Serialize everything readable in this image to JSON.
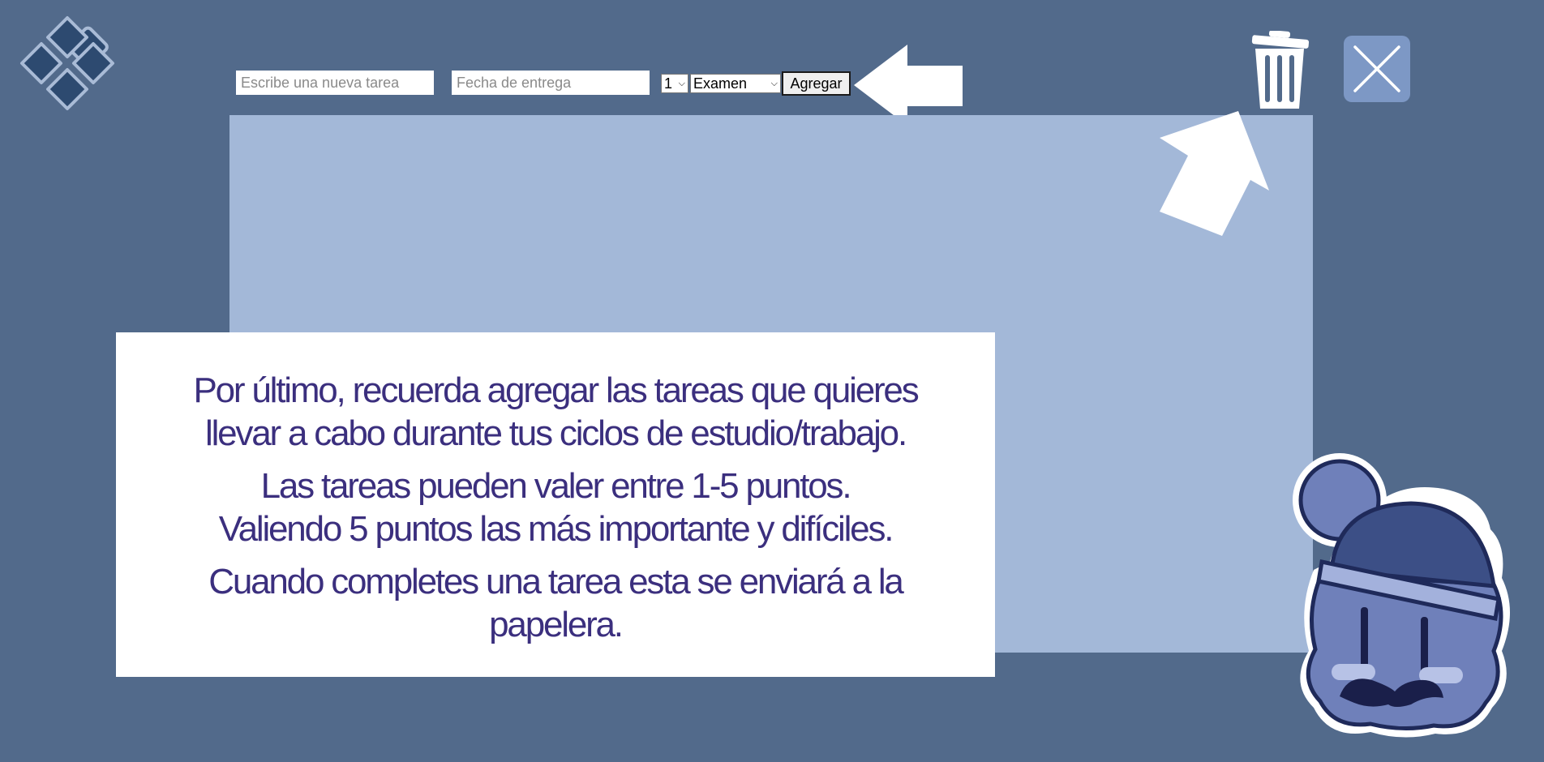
{
  "toolbar": {
    "task_placeholder": "Escribe una nueva tarea",
    "date_placeholder": "Fecha de entrega",
    "points_value": "1",
    "category_value": "Examen",
    "add_label": "Agregar"
  },
  "tutorial": {
    "line1": "Por último, recuerda agregar las tareas que quieres",
    "line2": "llevar a cabo durante tus ciclos de estudio/trabajo.",
    "line3": "Las tareas pueden valer entre 1-5 puntos.",
    "line4": "Valiendo 5 puntos las más importante y difíciles.",
    "line5": "Cuando completes una tarea esta se enviará a la",
    "line6": "papelera."
  },
  "icons": {
    "logo": "diamond-grid-icon",
    "trash": "trash-icon",
    "close": "close-icon",
    "arrow_left": "arrow-left-icon",
    "arrow_up": "arrow-up-icon",
    "mascot": "mascot-character"
  },
  "colors": {
    "background": "#526a8b",
    "panel": "#a3b8d8",
    "tutorial_bg": "#ffffff",
    "tutorial_text": "#3b2f7e",
    "close_button": "#7d98c5"
  }
}
